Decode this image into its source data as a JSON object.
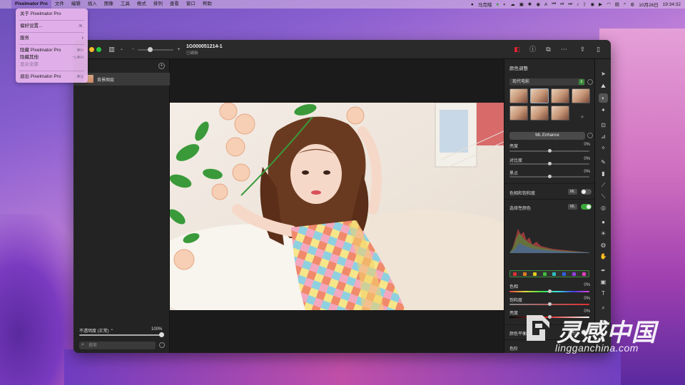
{
  "menubar": {
    "app_name": "Pixelmator Pro",
    "items": [
      "文件",
      "编辑",
      "插入",
      "图像",
      "工具",
      "格式",
      "排列",
      "查看",
      "窗口",
      "帮助"
    ],
    "user": "马克喵",
    "date": "10月26日",
    "time": "19:34:32",
    "battery_icon": "battery-icon",
    "wifi_icon": "wifi-icon",
    "badge_A": "A"
  },
  "app_menu": {
    "items": [
      {
        "label": "关于 Pixelmator Pro",
        "shortcut": "",
        "disabled": false
      },
      {
        "label": "偏好设置...",
        "shortcut": "⌘,",
        "disabled": false
      },
      {
        "label": "服务",
        "shortcut": "›",
        "disabled": false
      },
      {
        "label": "隐藏 Pixelmator Pro",
        "shortcut": "⌘H",
        "disabled": false
      },
      {
        "label": "隐藏其他",
        "shortcut": "⌥⌘H",
        "disabled": false
      },
      {
        "label": "显示全部",
        "shortcut": "",
        "disabled": true
      },
      {
        "label": "退出 Pixelmator Pro",
        "shortcut": "⌘Q",
        "disabled": false
      }
    ]
  },
  "window": {
    "doc_title": "1G000051214-1",
    "doc_status": "已编辑"
  },
  "layers": {
    "layer_name": "背景图层",
    "opacity_label": "不透明度 (正常) ⌃",
    "opacity_value": "100%",
    "opacity_fraction": 1.0,
    "search_placeholder": "搜索"
  },
  "adjust": {
    "header": "颜色调整",
    "preset": "现代电影",
    "ml_enhance": "ML Enhance",
    "rows": [
      {
        "label": "亮度",
        "value": "0%"
      },
      {
        "label": "对比度",
        "value": "0%"
      },
      {
        "label": "黑点",
        "value": "0%"
      }
    ],
    "hue_saturation": "色相和饱和度",
    "selective_color": "选择性颜色",
    "ml_tag": "ML",
    "hsl_rows": [
      {
        "label": "色相",
        "value": "0%"
      },
      {
        "label": "饱和度",
        "value": "0%"
      },
      {
        "label": "亮度",
        "value": "0%"
      }
    ],
    "color_balance": "颜色平衡",
    "levels": "色阶",
    "swatch_colors": [
      "#e03030",
      "#e08020",
      "#e0d020",
      "#40c040",
      "#30c0c0",
      "#3060e0",
      "#9040e0",
      "#e040c0"
    ]
  },
  "watermark": {
    "cn": "灵感中国",
    "en": "lingganchina.com"
  }
}
